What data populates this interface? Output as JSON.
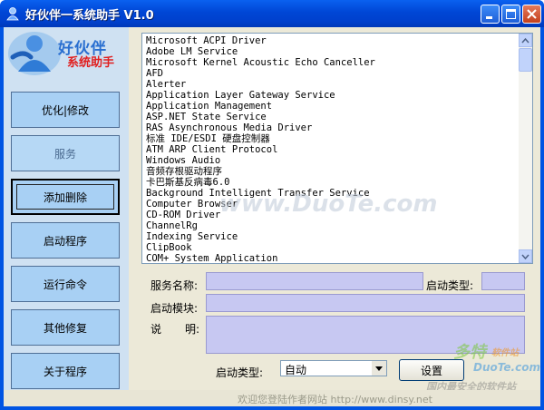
{
  "window": {
    "title": "好伙伴一系统助手 V1.0"
  },
  "logo": {
    "line1": "好伙伴",
    "line2": "系统助手"
  },
  "sidebar": {
    "items": [
      {
        "label": "优化|修改"
      },
      {
        "label": "服务"
      },
      {
        "label": "添加删除"
      },
      {
        "label": "启动程序"
      },
      {
        "label": "运行命令"
      },
      {
        "label": "其他修复"
      },
      {
        "label": "关于程序"
      }
    ]
  },
  "services": [
    "Microsoft ACPI Driver",
    "Adobe LM Service",
    "Microsoft Kernel Acoustic Echo Canceller",
    "AFD",
    "Alerter",
    "Application Layer Gateway Service",
    "Application Management",
    "ASP.NET State Service",
    "RAS Asynchronous Media Driver",
    "标准 IDE/ESDI 硬盘控制器",
    "ATM ARP Client Protocol",
    "Windows Audio",
    "音频存根驱动程序",
    "卡巴斯基反病毒6.0",
    "Background Intelligent Transfer Service",
    "Computer Browser",
    "CD-ROM Driver",
    "ChannelRg",
    "Indexing Service",
    "ClipBook",
    "COM+ System Application"
  ],
  "form": {
    "service_name_label": "服务名称:",
    "start_type_label": "启动类型:",
    "start_module_label": "启动模块:",
    "desc_label_1": "说",
    "desc_label_2": "明:",
    "start_type_select_label": "启动类型:",
    "start_type_value": "自动",
    "set_button": "设置"
  },
  "footer": {
    "text": "欢迎您登陆作者网站 http://www.dinsy.net"
  },
  "watermarks": {
    "center": "www.DuoTe.com",
    "corner_brand": "多特",
    "corner_brand_suffix": "软件站",
    "corner_url": "DuoTe.com",
    "corner_slogan": "国内最安全的软件站"
  },
  "colors": {
    "titlebar": "#0046d5",
    "sidebar": "#cfe1f2",
    "nav_button": "#a8d0f4",
    "input_field": "#c7c8f2"
  }
}
